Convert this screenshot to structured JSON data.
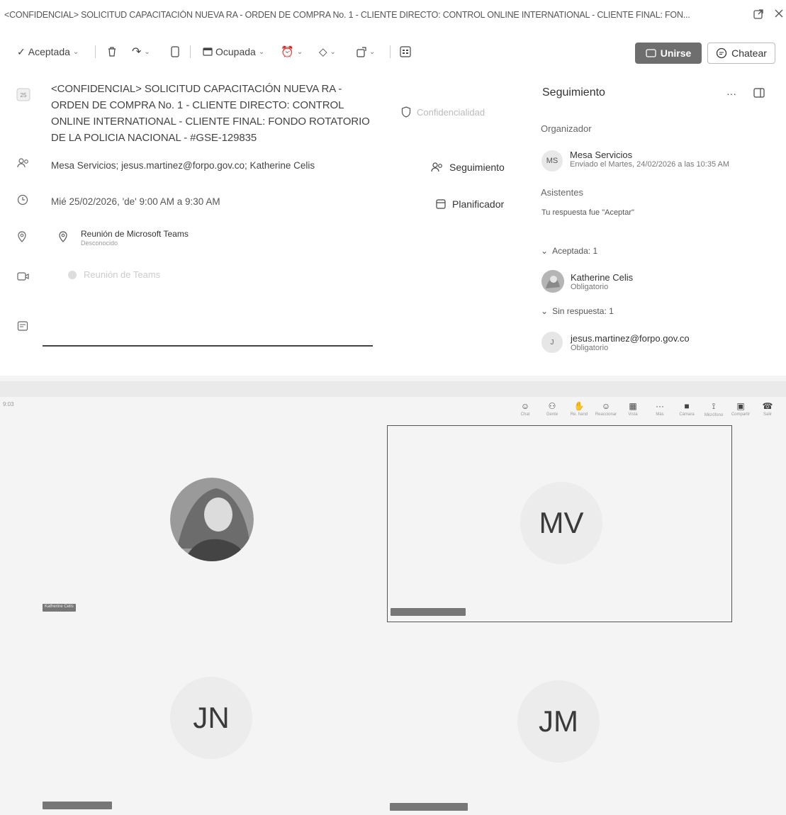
{
  "title_bar": {
    "title": "<CONFIDENCIAL> SOLICITUD CAPACITACIÓN NUEVA RA - ORDEN DE COMPRA No. 1 - CLIENTE DIRECTO: CONTROL ONLINE INTERNATIONAL - CLIENTE FINAL: FON...",
    "popout_icon": "popout-icon",
    "close_icon": "close-icon"
  },
  "toolbar": {
    "accepted_label": "Aceptada",
    "busy_label": "Ocupada",
    "join_label": "Unirse",
    "chat_label": "Chatear"
  },
  "details": {
    "subject": "<CONFIDENCIAL> SOLICITUD CAPACITACIÓN NUEVA RA - ORDEN DE COMPRA No. 1 - CLIENTE DIRECTO: CONTROL ONLINE INTERNATIONAL - CLIENTE FINAL: FONDO ROTATORIO DE LA POLICIA NACIONAL - #GSE-129835",
    "confidentiality": "Confidencialidad",
    "attendees": "Mesa Servicios; jesus.martinez@forpo.gov.co; Katherine Celis",
    "datetime": "Mié 25/02/2026, 'de' 9:00 AM a 9:30 AM",
    "location_name": "Reunión de Microsoft Teams",
    "location_status": "Desconocido",
    "teams_meeting_label": "Reunión de Teams",
    "tracking_button": "Seguimiento",
    "planner_button": "Planificador"
  },
  "tracking": {
    "title": "Seguimiento",
    "organizer_label": "Organizador",
    "organizer_initials": "MS",
    "organizer_name": "Mesa Servicios",
    "organizer_sent": "Enviado el Martes, 24/02/2026 a las 10:35 AM",
    "attendees_label": "Asistentes",
    "response_text": "Tu respuesta fue \"Aceptar\"",
    "accepted_group": "Aceptada: 1",
    "accepted_name": "Katherine Celis",
    "accepted_role": "Obligatorio",
    "noresponse_group": "Sin respuesta: 1",
    "noresponse_initial": "J",
    "noresponse_name": "jesus.martinez@forpo.gov.co",
    "noresponse_role": "Obligatorio"
  },
  "call": {
    "time": "9:03",
    "controls": [
      {
        "icon": "chat-icon",
        "label": "Chat"
      },
      {
        "icon": "people-icon",
        "label": "Gente"
      },
      {
        "icon": "raise-hand-icon",
        "label": "Re. hand"
      },
      {
        "icon": "react-icon",
        "label": "Reaccionar"
      },
      {
        "icon": "view-icon",
        "label": "Vista"
      },
      {
        "icon": "more-icon",
        "label": "Más"
      },
      {
        "icon": "camera-icon",
        "label": "Cámara"
      },
      {
        "icon": "mic-icon",
        "label": "Micrófono"
      },
      {
        "icon": "share-icon",
        "label": "Compartir"
      },
      {
        "icon": "leave-icon",
        "label": "Salir"
      }
    ],
    "tiles": [
      {
        "initials": "",
        "label": "Katherine Celis"
      },
      {
        "initials": "MV",
        "label": ""
      },
      {
        "initials": "JN",
        "label": ""
      },
      {
        "initials": "JM",
        "label": ""
      }
    ]
  }
}
